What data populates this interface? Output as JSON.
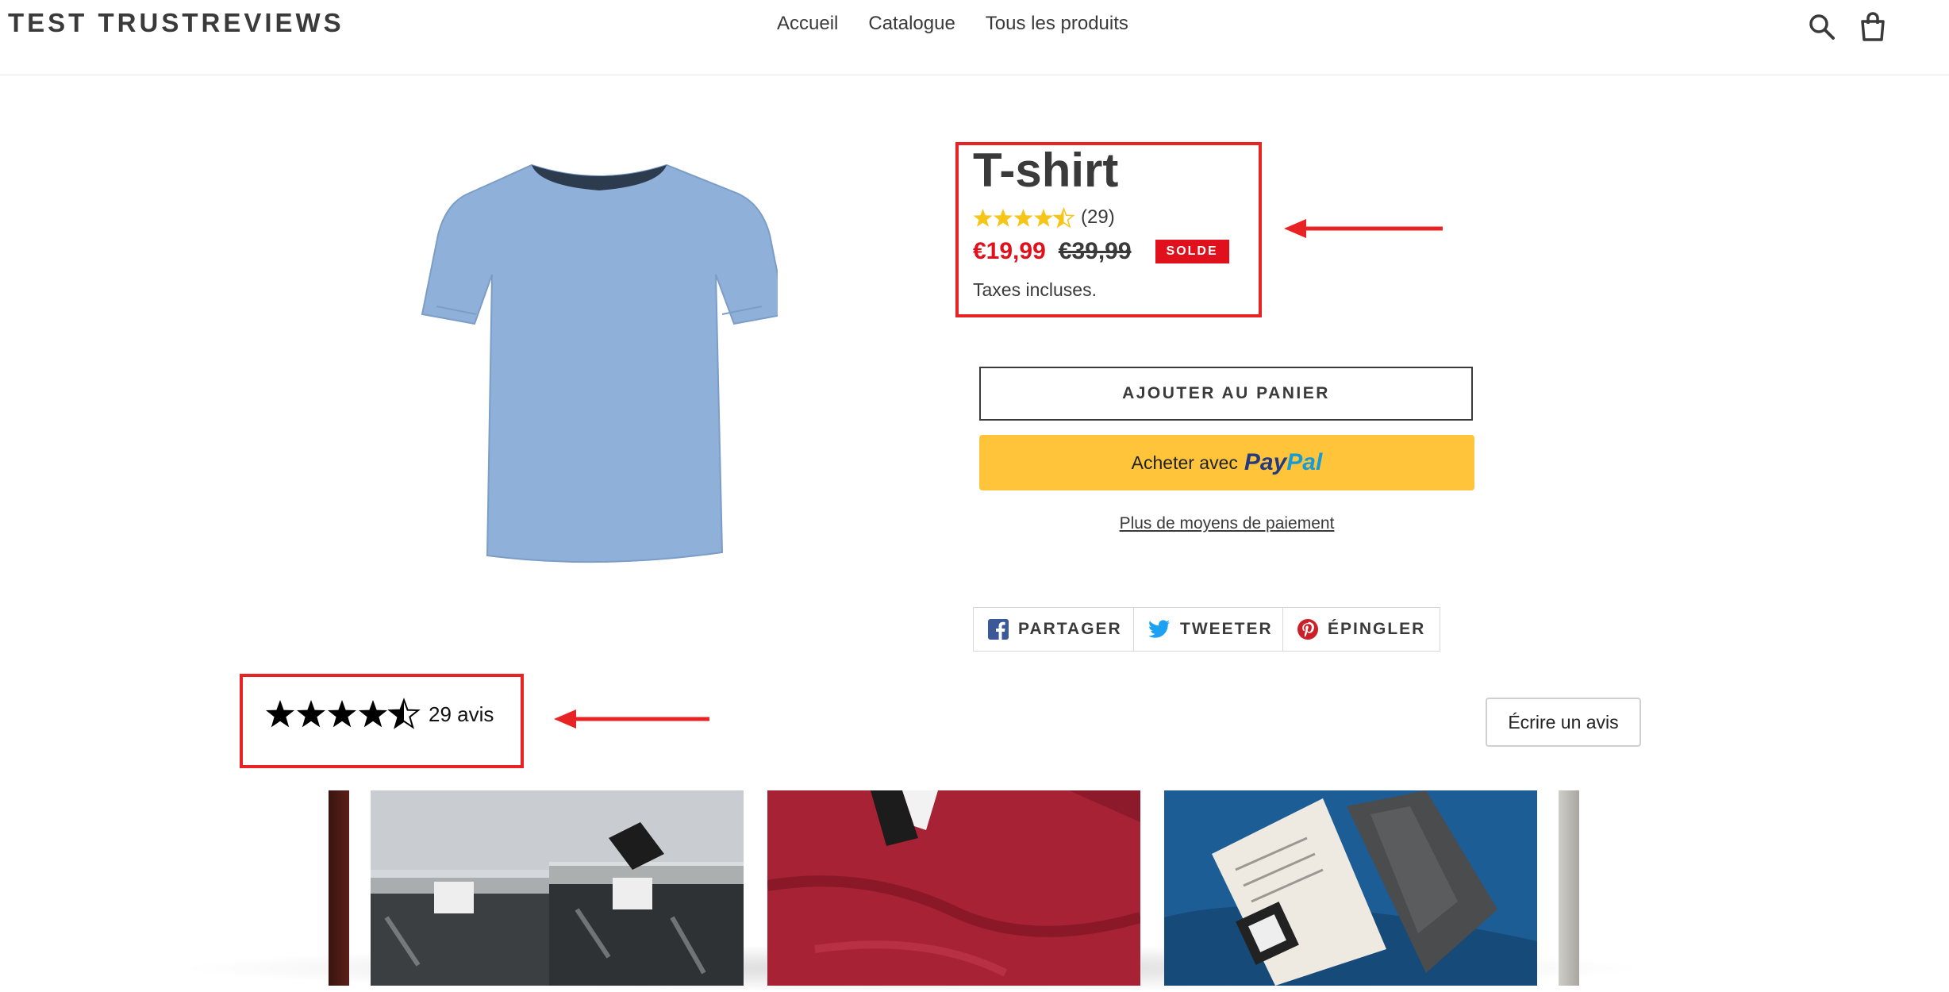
{
  "header": {
    "logo": "TEST TRUSTREVIEWS",
    "nav": [
      "Accueil",
      "Catalogue",
      "Tous les produits"
    ],
    "icons": [
      "search-icon",
      "cart-icon"
    ]
  },
  "product": {
    "title": "T-shirt",
    "rating": {
      "stars": 4.5,
      "count_label": "(29)"
    },
    "price_sale": "€19,99",
    "price_compare": "€39,99",
    "badge": "SOLDE",
    "tax_note": "Taxes incluses.",
    "image_color": "#8fb0d8"
  },
  "actions": {
    "add_to_cart": "AJOUTER AU PANIER",
    "paypal_prefix": "Acheter avec",
    "paypal_logo_a": "Pay",
    "paypal_logo_b": "Pal",
    "more_payment": "Plus de moyens de paiement"
  },
  "share": {
    "facebook": "PARTAGER",
    "twitter": "TWEETER",
    "pinterest": "ÉPINGLER"
  },
  "reviews": {
    "stars": 4.5,
    "count_label": "29 avis",
    "write_button": "Écrire un avis"
  },
  "colors": {
    "accent_red": "#e0101c",
    "highlight_red": "#e82323",
    "star_gold": "#f5c518",
    "paypal_yellow": "#ffc439"
  }
}
